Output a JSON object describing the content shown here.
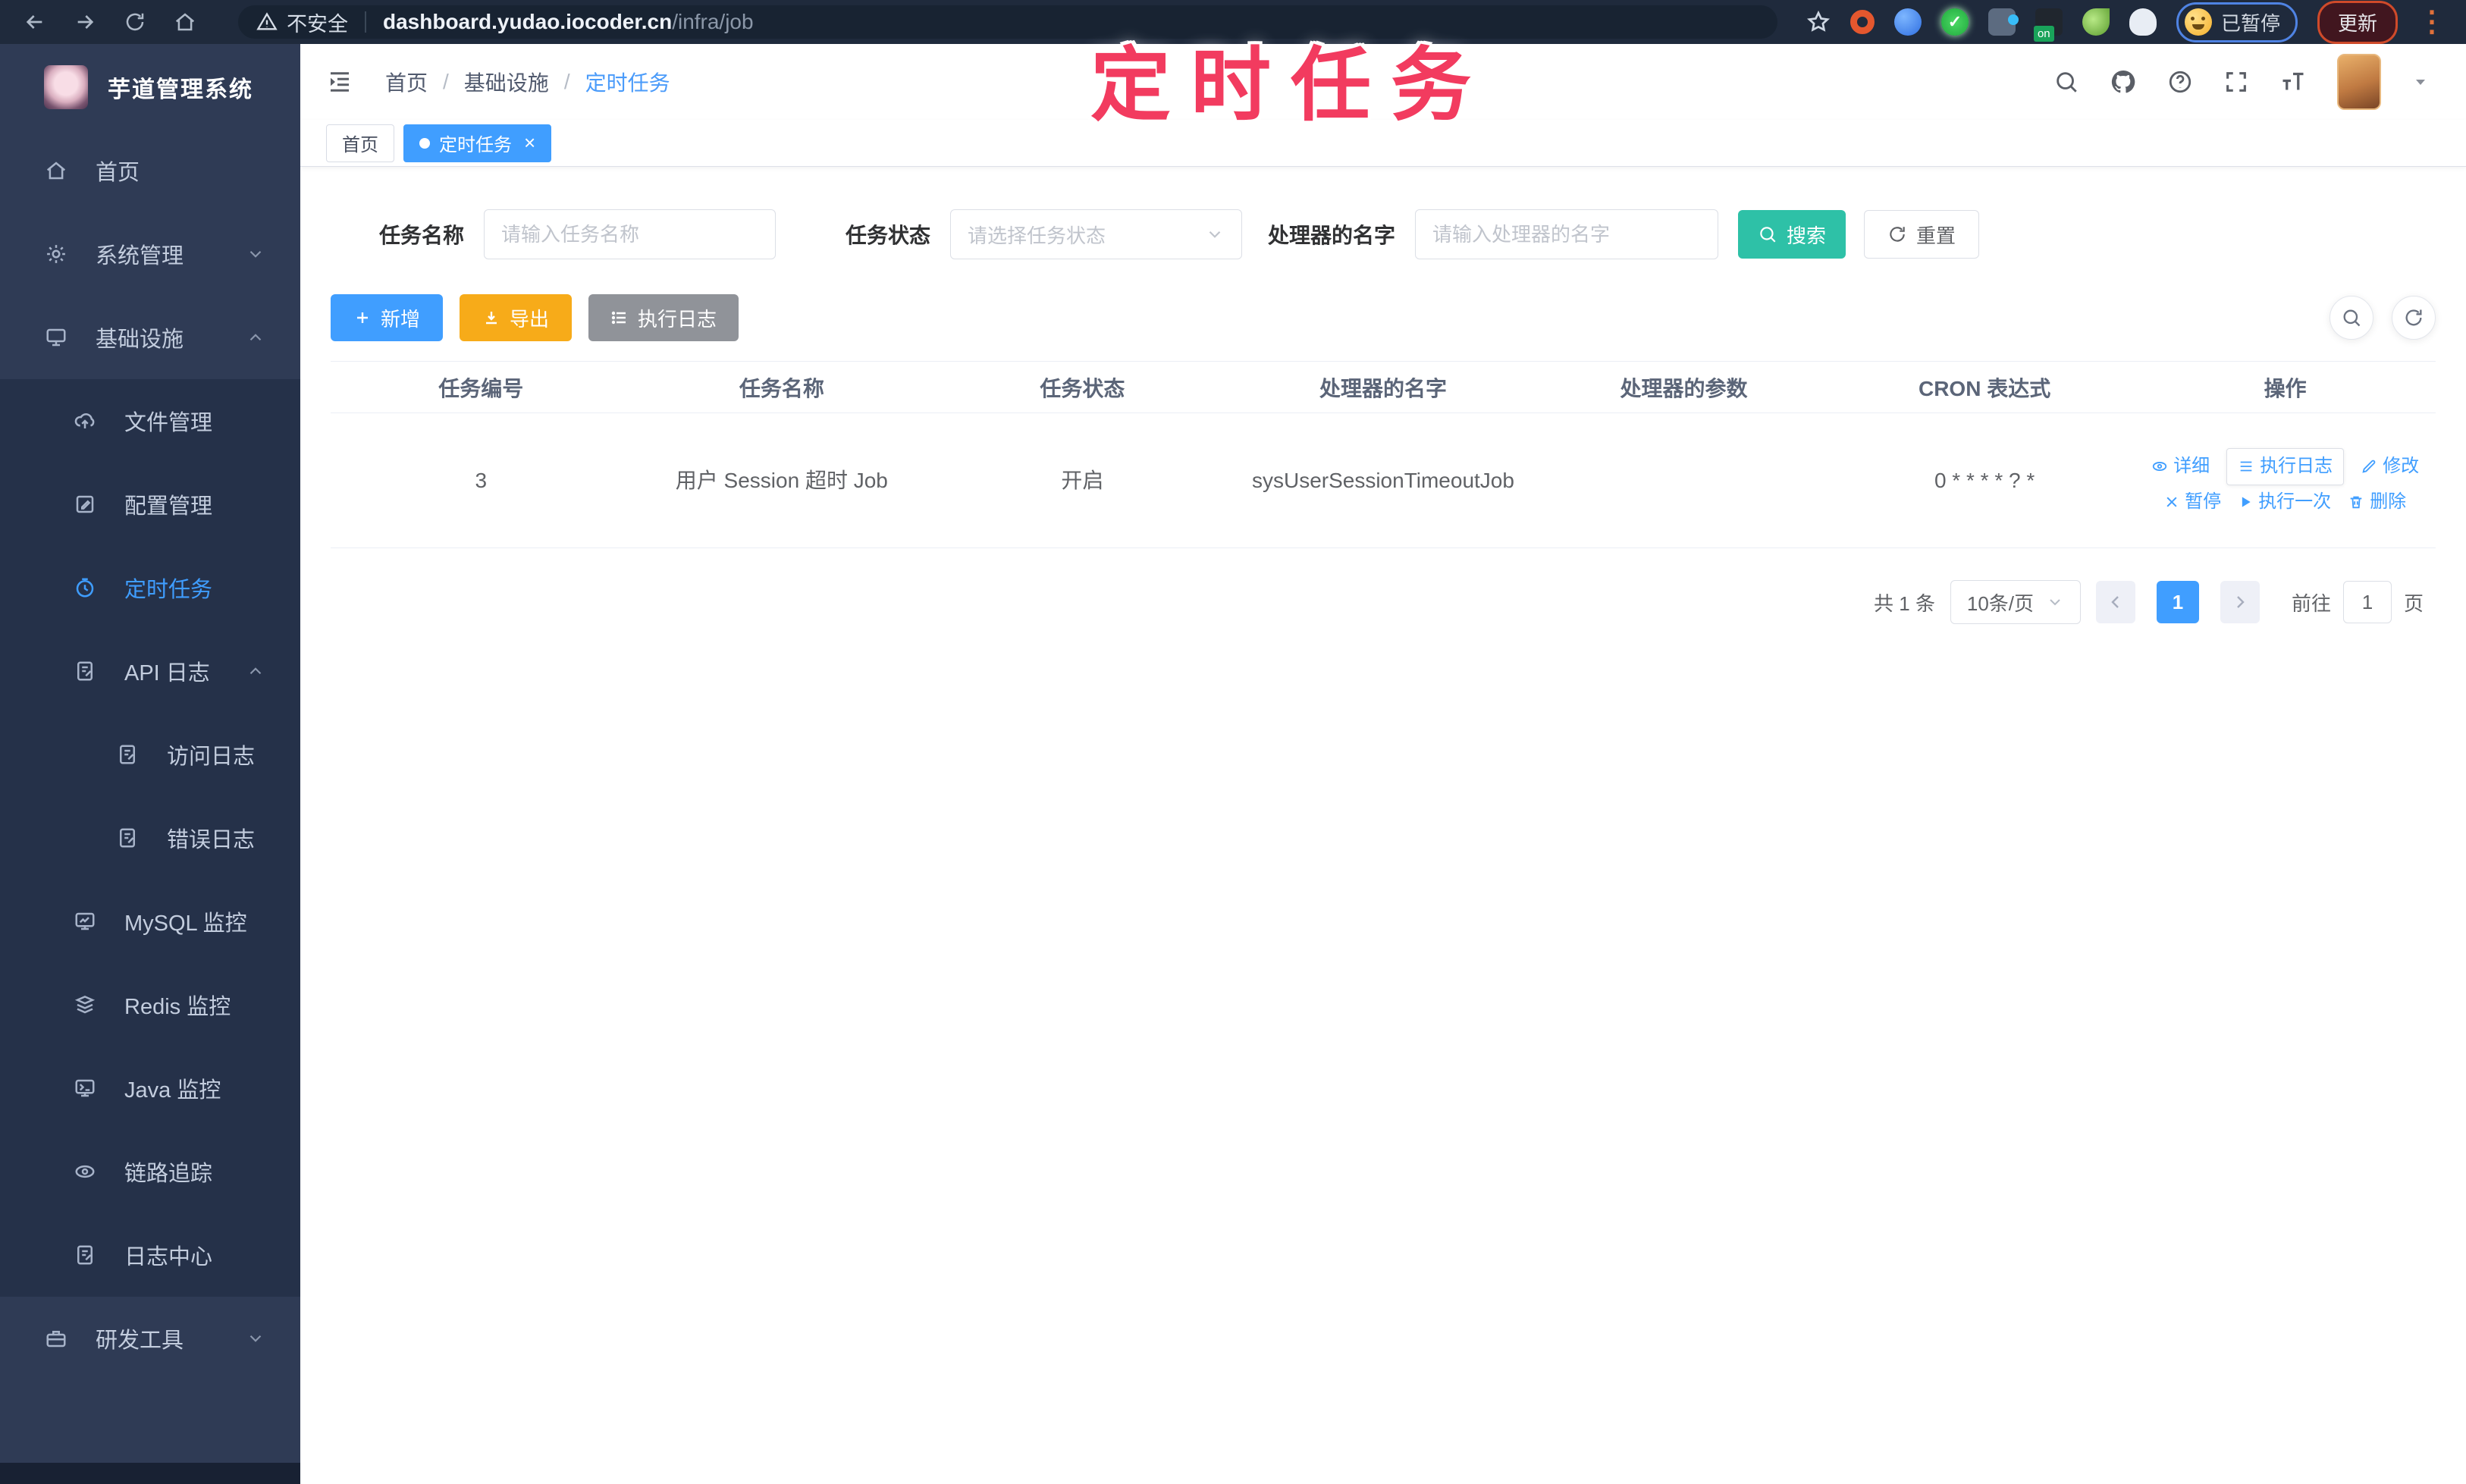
{
  "overlay": {
    "title": "定时任务"
  },
  "colors": {
    "accent_blue": "#409eff",
    "search_teal": "#2ec1a7",
    "export_yellow": "#f7ab19",
    "info_gray": "#909399",
    "annotation_pink": "#f23b5f",
    "sidebar_bg": "#2f3b55",
    "submenu_bg": "#253149",
    "browser_bar_bg": "#1f2a3c"
  },
  "browser": {
    "security_label": "不安全",
    "url_host": "dashboard.yudao.iocoder.cn",
    "url_path": "/infra/job",
    "extension_badge": "on",
    "paused_chip": "已暂停",
    "update_button": "更新"
  },
  "sidebar": {
    "app_title": "芋道管理系统",
    "items": [
      {
        "label": "首页"
      },
      {
        "label": "系统管理"
      },
      {
        "label": "基础设施"
      },
      {
        "label": "文件管理"
      },
      {
        "label": "配置管理"
      },
      {
        "label": "定时任务"
      },
      {
        "label": "API 日志"
      },
      {
        "label": "访问日志"
      },
      {
        "label": "错误日志"
      },
      {
        "label": "MySQL 监控"
      },
      {
        "label": "Redis 监控"
      },
      {
        "label": "Java 监控"
      },
      {
        "label": "链路追踪"
      },
      {
        "label": "日志中心"
      },
      {
        "label": "研发工具"
      }
    ]
  },
  "header": {
    "breadcrumb": [
      "首页",
      "基础设施",
      "定时任务"
    ],
    "breadcrumb_separator": "/"
  },
  "tags": [
    {
      "label": "首页"
    },
    {
      "label": "定时任务",
      "close": "×"
    }
  ],
  "search": {
    "name_label": "任务名称",
    "name_placeholder": "请输入任务名称",
    "status_label": "任务状态",
    "status_placeholder": "请选择任务状态",
    "handler_label": "处理器的名字",
    "handler_placeholder": "请输入处理器的名字",
    "search_button": "搜索",
    "reset_button": "重置"
  },
  "toolbar": {
    "add_label": "新增",
    "export_label": "导出",
    "job_log_label": "执行日志"
  },
  "table": {
    "headers": [
      "任务编号",
      "任务名称",
      "任务状态",
      "处理器的名字",
      "处理器的参数",
      "CRON 表达式",
      "操作"
    ],
    "rows": [
      {
        "id": "3",
        "name": "用户 Session 超时 Job",
        "status": "开启",
        "handler": "sysUserSessionTimeoutJob",
        "params": "",
        "cron": "0 * * * * ? *",
        "actions": [
          "详细",
          "执行日志",
          "修改",
          "暂停",
          "执行一次",
          "删除"
        ]
      }
    ]
  },
  "pagination": {
    "total": "共 1 条",
    "page_size": "10条/页",
    "current_page": "1",
    "goto_label": "前往",
    "goto_value": "1",
    "page_unit": "页"
  }
}
